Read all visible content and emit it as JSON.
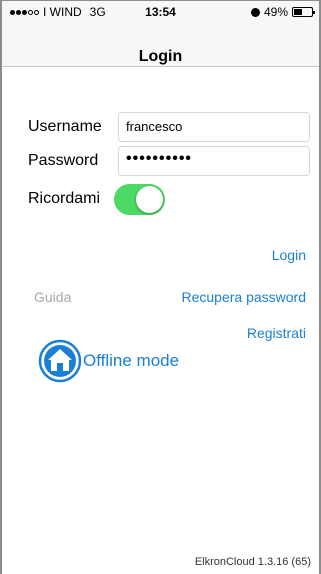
{
  "status_bar": {
    "carrier": "I WIND",
    "network": "3G",
    "time": "13:54",
    "battery_percent_label": "49%",
    "battery_level": 0.49,
    "signal_icon": "signal-dots-icon",
    "moon_icon": "do-not-disturb-icon",
    "battery_icon": "battery-icon"
  },
  "nav": {
    "title": "Login"
  },
  "form": {
    "username_label": "Username",
    "username_value": "francesco",
    "password_label": "Password",
    "password_value": "••••••••••",
    "remember_label": "Ricordami",
    "remember_on": true
  },
  "actions": {
    "login": "Login",
    "guide": "Guida",
    "recover_password": "Recupera password",
    "register": "Registrati",
    "offline_mode": "Offline mode",
    "offline_icon": "home-icon"
  },
  "footer": {
    "version": "ElkronCloud 1.3.16 (65)"
  },
  "colors": {
    "link": "#1a7fd6",
    "toggle_on": "#4cd964",
    "muted": "#a8a8a8",
    "bar_bg": "#f7f7f7"
  }
}
